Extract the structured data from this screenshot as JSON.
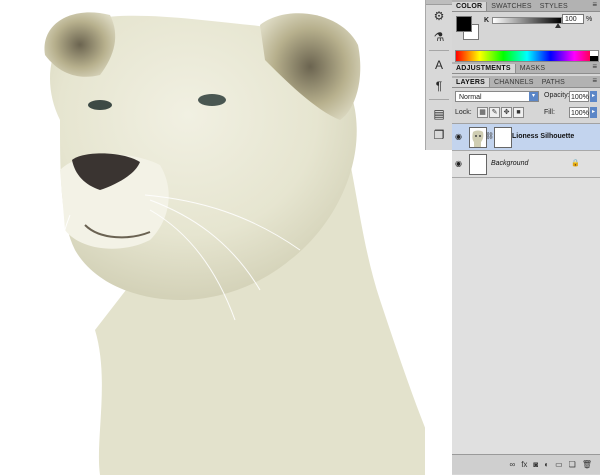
{
  "canvas": {
    "background": "#ffffff",
    "fur_color": "#e8e8d4",
    "shadow_color": "#c8c7ad"
  },
  "tools": [
    {
      "name": "clone-source-icon",
      "glyph": "⚙"
    },
    {
      "name": "brush-presets-icon",
      "glyph": "⚗"
    },
    {
      "name": "character-icon",
      "glyph": "A"
    },
    {
      "name": "paragraph-icon",
      "glyph": "¶"
    },
    {
      "name": "layer-comps-icon",
      "glyph": "▤"
    },
    {
      "name": "history-icon",
      "glyph": "❐"
    }
  ],
  "color_panel": {
    "tabs": [
      "COLOR",
      "SWATCHES",
      "STYLES"
    ],
    "channel_label": "K",
    "channel_value": "100",
    "channel_unit": "%",
    "foreground": "#000000",
    "background": "#ffffff"
  },
  "adjustments_panel": {
    "tabs": [
      "ADJUSTMENTS",
      "MASKS"
    ]
  },
  "layers_panel": {
    "tabs": [
      "LAYERS",
      "CHANNELS",
      "PATHS"
    ],
    "blend_mode": "Normal",
    "opacity_label": "Opacity:",
    "opacity_value": "100%",
    "lock_label": "Lock:",
    "fill_label": "Fill:",
    "fill_value": "100%",
    "layers": [
      {
        "name": "Lioness Silhouette",
        "selected": true
      },
      {
        "name": "Background",
        "selected": false
      }
    ]
  },
  "bottom_icons": [
    "link-layers-icon",
    "fx-icon",
    "add-mask-icon",
    "adjustment-layer-icon",
    "new-group-icon",
    "new-layer-icon",
    "delete-layer-icon"
  ],
  "colors": {
    "selection": "#c3d4ee",
    "accent_blue": "#5b86c7"
  }
}
